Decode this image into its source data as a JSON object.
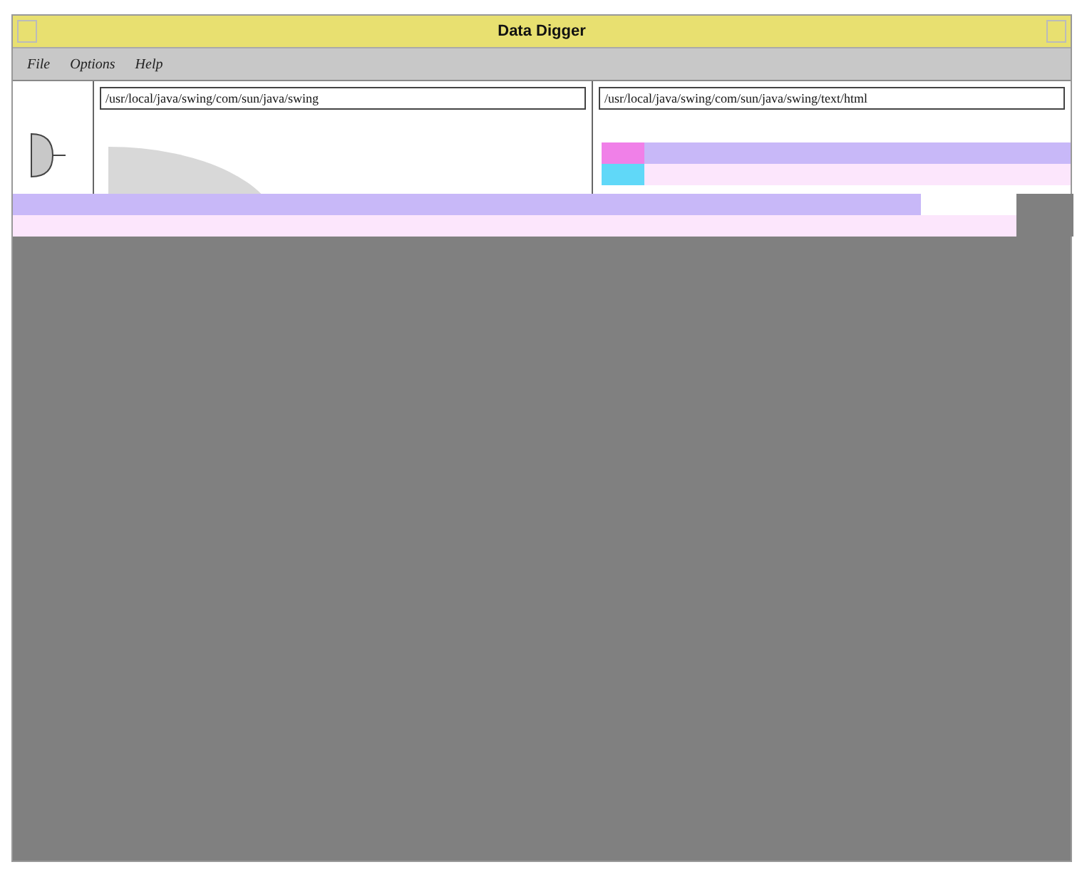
{
  "window": {
    "title": "Data Digger"
  },
  "menu": [
    {
      "label": "File"
    },
    {
      "label": "Options"
    },
    {
      "label": "Help"
    }
  ],
  "panes": [
    {
      "path": "/usr/local/java/swing/com/sun/java/swing"
    },
    {
      "path": "/usr/local/java/swing/com/sun/java/swing/text/html"
    }
  ]
}
